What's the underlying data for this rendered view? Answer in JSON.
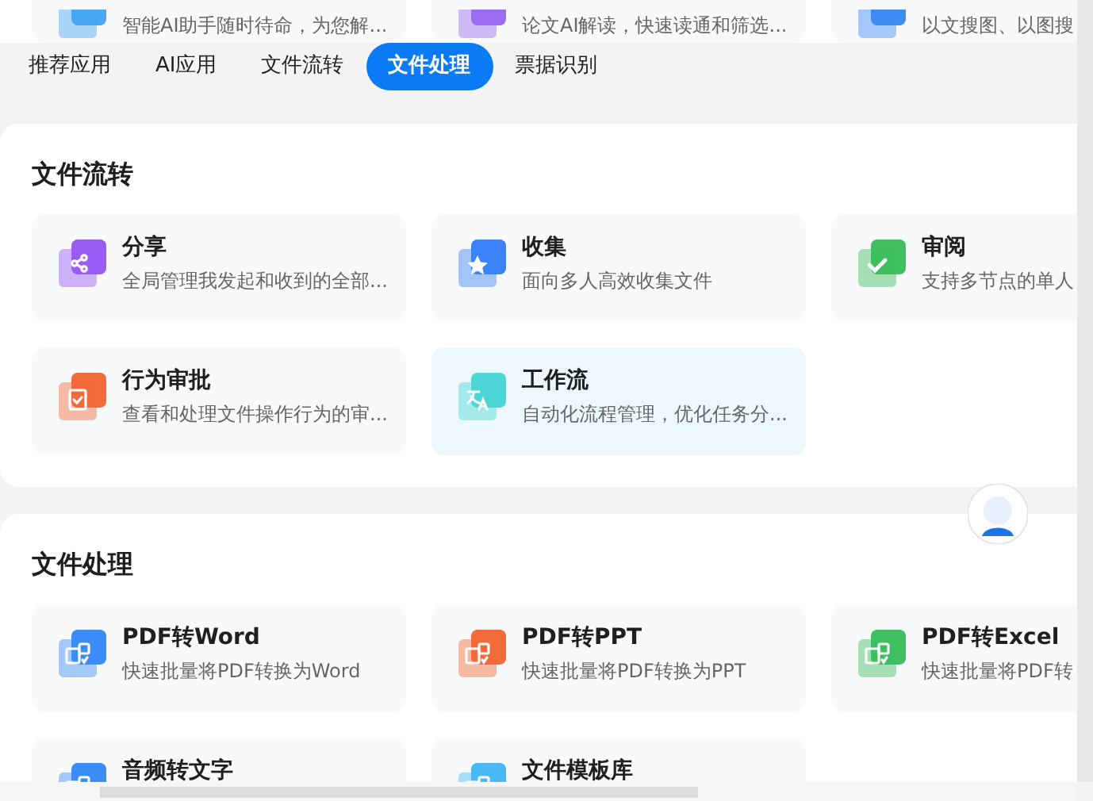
{
  "top_cards": [
    {
      "description": "智能AI助手随时待命，为您解...",
      "color": "#4aa8f5"
    },
    {
      "description": "论文AI解读，快速读通和筛选...",
      "color": "#9b6cf0"
    },
    {
      "description": "以文搜图、以图搜",
      "color": "#3f8cf5"
    }
  ],
  "tabs": [
    {
      "label": "推荐应用",
      "selected": false
    },
    {
      "label": "AI应用",
      "selected": false
    },
    {
      "label": "文件流转",
      "selected": false
    },
    {
      "label": "文件处理",
      "selected": true
    },
    {
      "label": "票据识别",
      "selected": false
    }
  ],
  "sections": [
    {
      "title": "文件流转",
      "cards": [
        {
          "kind": "share",
          "title": "分享",
          "description": "全局管理我发起和收到的全部...",
          "color": "#9b5cf6",
          "highlighted": false
        },
        {
          "kind": "star",
          "title": "收集",
          "description": "面向多人高效收集文件",
          "color": "#3b82f6",
          "highlighted": false
        },
        {
          "kind": "check",
          "title": "审阅",
          "description": "支持多节点的单人",
          "color": "#3fbf5f",
          "highlighted": false
        },
        {
          "kind": "stamp",
          "title": "行为审批",
          "description": "查看和处理文件操作行为的审...",
          "color": "#f26b3a",
          "highlighted": false
        },
        {
          "kind": "translate",
          "title": "工作流",
          "description": "自动化流程管理，优化任务分...",
          "color": "#4dd6d6",
          "highlighted": true
        }
      ]
    },
    {
      "title": "文件处理",
      "cards": [
        {
          "kind": "doc",
          "title": "PDF转Word",
          "description": "快速批量将PDF转换为Word",
          "color": "#3b8cf6",
          "highlighted": false
        },
        {
          "kind": "doc",
          "title": "PDF转PPT",
          "description": "快速批量将PDF转换为PPT",
          "color": "#f26b3a",
          "highlighted": false
        },
        {
          "kind": "doc",
          "title": "PDF转Excel",
          "description": "快速批量将PDF转",
          "color": "#3fbf5f",
          "highlighted": false
        },
        {
          "kind": "doc",
          "title": "音频转文字",
          "color": "#3b8cf6",
          "highlighted": false
        },
        {
          "kind": "doc",
          "title": "文件模板库",
          "color": "#4ab8f5",
          "highlighted": false
        }
      ]
    }
  ]
}
